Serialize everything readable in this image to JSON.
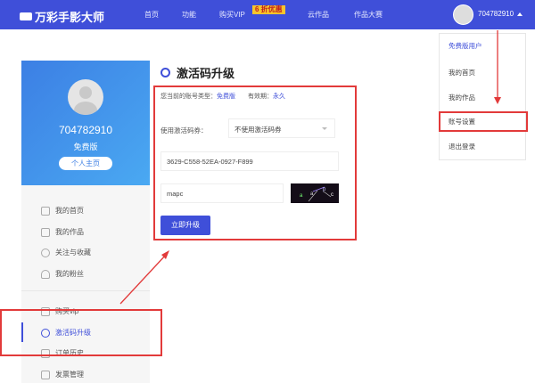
{
  "header": {
    "logo": "万彩手影大师",
    "nav": [
      "首页",
      "功能",
      "购买VIP",
      "云作品",
      "作品大赛"
    ],
    "badge": "6 折优惠",
    "username": "704782910"
  },
  "dropdown": {
    "items": [
      "免费版用户",
      "我的首页",
      "我的作品",
      "账号设置",
      "退出登录"
    ]
  },
  "profile": {
    "id": "704782910",
    "version": "免费版",
    "home_button": "个人主页"
  },
  "sidebar": {
    "items": [
      "我的首页",
      "我的作品",
      "关注与收藏",
      "我的粉丝",
      "购买vip",
      "激活码升级",
      "订单历史",
      "发票管理"
    ]
  },
  "main": {
    "title": "激活码升级",
    "account_type_label": "您当前的账号类型：",
    "account_type": "免费版",
    "validity_label": "有效期：",
    "validity": "永久",
    "coupon_label": "使用激活码券：",
    "coupon_select": "不使用激活码券",
    "code_value": "3629-C558-52EA-0927-F899",
    "captcha_value": "mapc",
    "captcha_text": "a a p c",
    "upgrade_button": "立即升级"
  },
  "colors": {
    "brand": "#3f4fd9",
    "highlight": "#e23a3a"
  }
}
